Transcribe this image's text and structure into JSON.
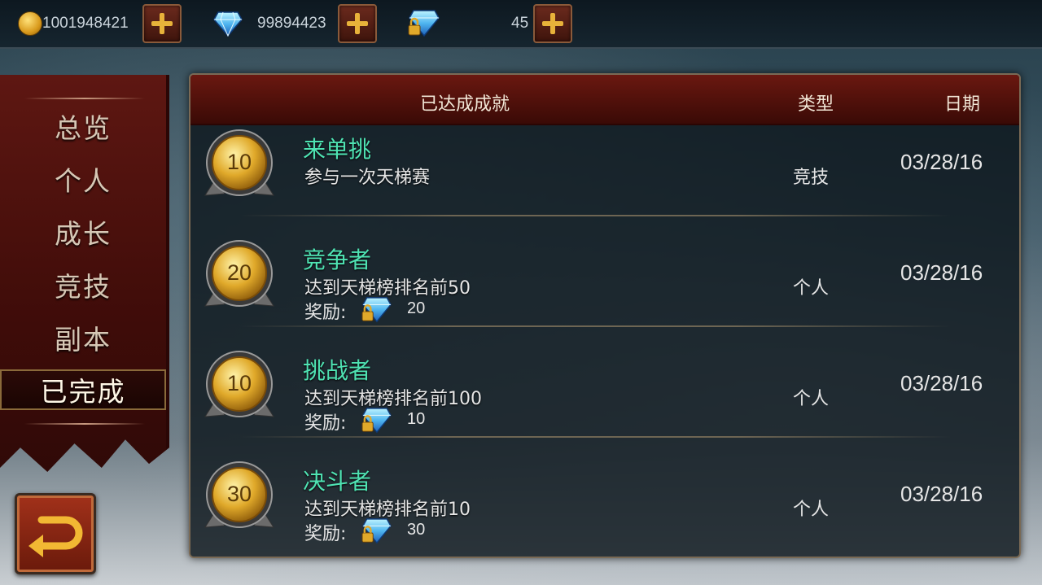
{
  "currencies": {
    "gold": {
      "value": "1001948421"
    },
    "diamonds": {
      "value": "99894423"
    },
    "bound_diamonds": {
      "value": "45"
    }
  },
  "sidebar": {
    "items": [
      {
        "label": "总览",
        "active": false
      },
      {
        "label": "个人",
        "active": false
      },
      {
        "label": "成长",
        "active": false
      },
      {
        "label": "竞技",
        "active": false
      },
      {
        "label": "副本",
        "active": false
      },
      {
        "label": "已完成",
        "active": true
      }
    ]
  },
  "panel": {
    "headers": {
      "achievement": "已达成成就",
      "type": "类型",
      "date": "日期"
    },
    "reward_label": "奖励:",
    "rows": [
      {
        "points": "10",
        "title": "来单挑",
        "desc": "参与一次天梯赛",
        "reward": "",
        "type": "竞技",
        "date": "03/28/16"
      },
      {
        "points": "20",
        "title": "竞争者",
        "desc": "达到天梯榜排名前50",
        "reward": "20",
        "type": "个人",
        "date": "03/28/16"
      },
      {
        "points": "10",
        "title": "挑战者",
        "desc": "达到天梯榜排名前100",
        "reward": "10",
        "type": "个人",
        "date": "03/28/16"
      },
      {
        "points": "30",
        "title": "决斗者",
        "desc": "达到天梯榜排名前10",
        "reward": "30",
        "type": "个人",
        "date": "03/28/16"
      }
    ]
  },
  "colors": {
    "title_green": "#4fe3b3",
    "header_red": "#6a1810",
    "medal_gold": "#e0a92a"
  },
  "icons": {
    "gold": "gold-coin-icon",
    "diamond": "diamond-icon",
    "locked_diamond": "locked-diamond-icon",
    "add": "plus-icon",
    "back": "back-arrow-icon",
    "medal": "medal-icon"
  }
}
